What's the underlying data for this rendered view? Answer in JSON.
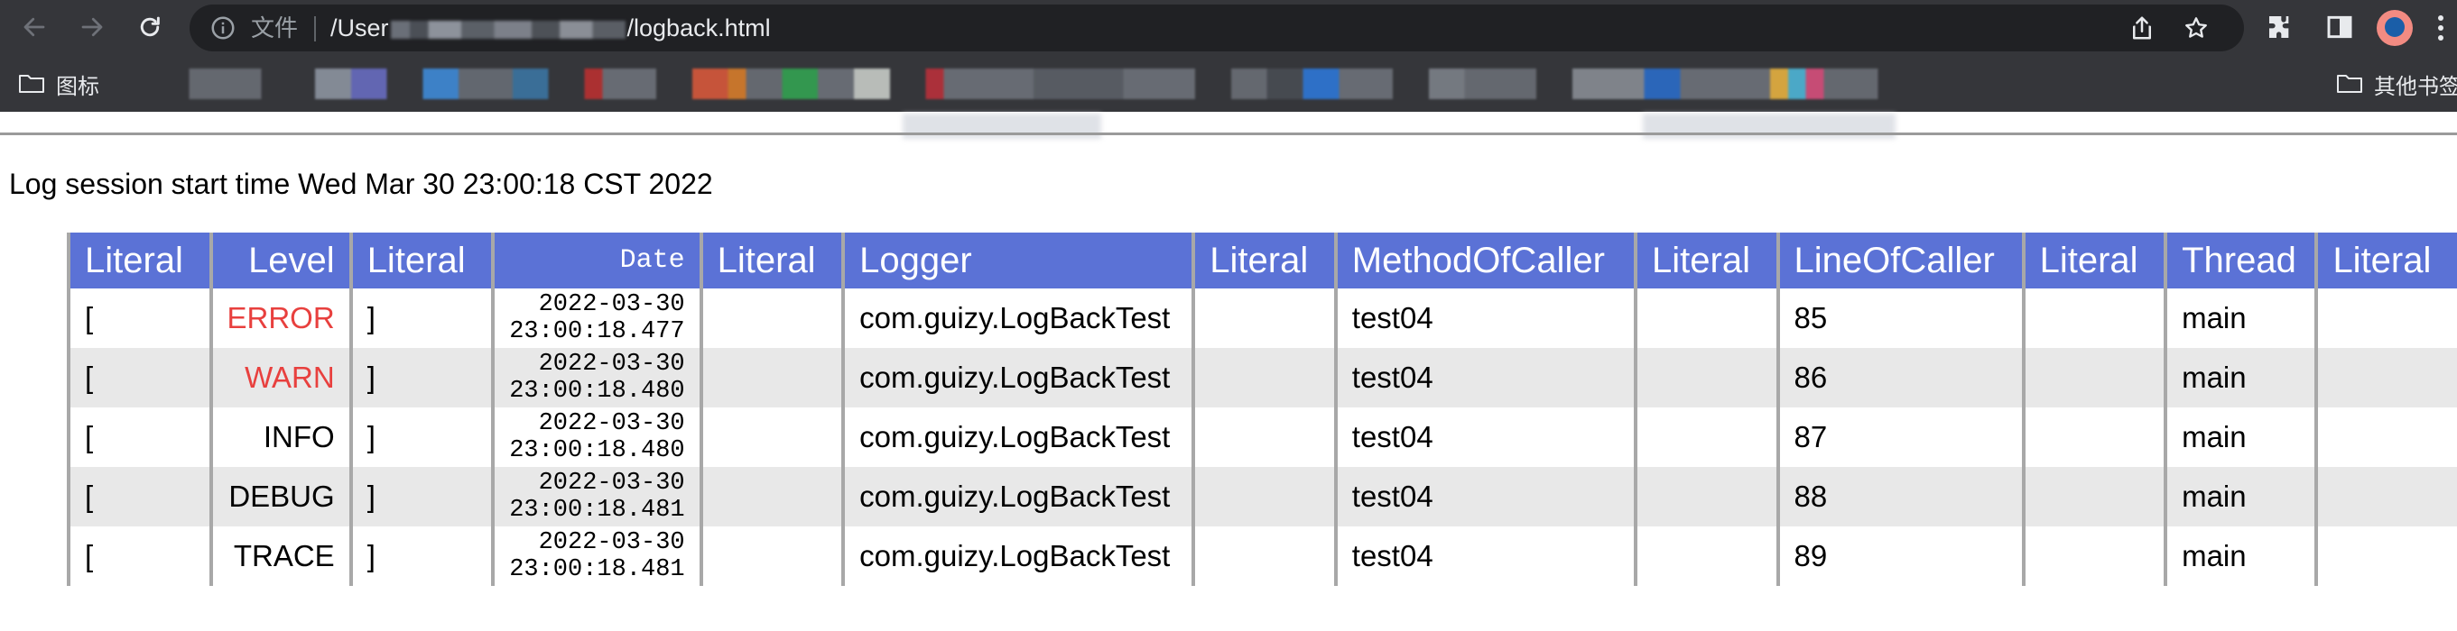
{
  "browser": {
    "url_scheme": "文件",
    "url_prefix": "/User",
    "url_suffix": "/logback.html",
    "bookmarks_first": "图标",
    "bookmarks_other": "其他书签"
  },
  "page": {
    "session_text": "Log session start time Wed Mar 30 23:00:18 CST 2022"
  },
  "table": {
    "headers": [
      "Literal",
      "Level",
      "Literal",
      "Date",
      "Literal",
      "Logger",
      "Literal",
      "MethodOfCaller",
      "Literal",
      "LineOfCaller",
      "Literal",
      "Thread",
      "Literal"
    ],
    "rows": [
      {
        "lit1": "[",
        "level": "ERROR",
        "lit2": "]",
        "date1": "2022-03-30",
        "date2": "23:00:18.477",
        "lit3": "",
        "logger": "com.guizy.LogBackTest",
        "lit4": "",
        "method": "test04",
        "lit5": "",
        "line": "85",
        "lit6": "",
        "thread": "main",
        "lit7": ""
      },
      {
        "lit1": "[",
        "level": "WARN",
        "lit2": "]",
        "date1": "2022-03-30",
        "date2": "23:00:18.480",
        "lit3": "",
        "logger": "com.guizy.LogBackTest",
        "lit4": "",
        "method": "test04",
        "lit5": "",
        "line": "86",
        "lit6": "",
        "thread": "main",
        "lit7": ""
      },
      {
        "lit1": "[",
        "level": "INFO",
        "lit2": "]",
        "date1": "2022-03-30",
        "date2": "23:00:18.480",
        "lit3": "",
        "logger": "com.guizy.LogBackTest",
        "lit4": "",
        "method": "test04",
        "lit5": "",
        "line": "87",
        "lit6": "",
        "thread": "main",
        "lit7": ""
      },
      {
        "lit1": "[",
        "level": "DEBUG",
        "lit2": "]",
        "date1": "2022-03-30",
        "date2": "23:00:18.481",
        "lit3": "",
        "logger": "com.guizy.LogBackTest",
        "lit4": "",
        "method": "test04",
        "lit5": "",
        "line": "88",
        "lit6": "",
        "thread": "main",
        "lit7": ""
      },
      {
        "lit1": "[",
        "level": "TRACE",
        "lit2": "]",
        "date1": "2022-03-30",
        "date2": "23:00:18.481",
        "lit3": "",
        "logger": "com.guizy.LogBackTest",
        "lit4": "",
        "method": "test04",
        "lit5": "",
        "line": "89",
        "lit6": "",
        "thread": "main",
        "lit7": ""
      }
    ]
  },
  "colors": {
    "header_bg": "#5b72d6",
    "error_level": "#e8403e",
    "warn_level": "#e8403e",
    "alt_row": "#e8e8e8"
  },
  "icons": [
    "back-icon",
    "forward-icon",
    "reload-icon",
    "info-icon",
    "share-icon",
    "star-icon",
    "extensions-icon",
    "sidepanel-icon",
    "avatar",
    "menu-icon",
    "folder-icon"
  ]
}
